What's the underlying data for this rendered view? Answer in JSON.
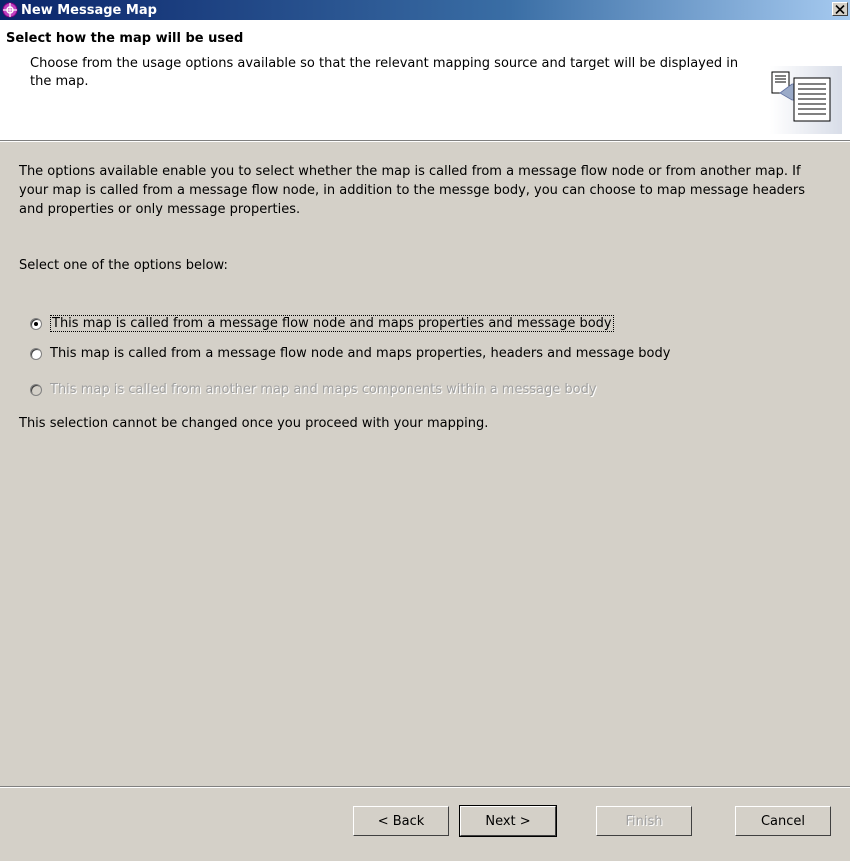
{
  "window": {
    "title": "New Message Map",
    "close_label": "✕"
  },
  "header": {
    "title": "Select how the map will be used",
    "description": "Choose from the usage options available so that the relevant mapping source and target will be displayed in the map."
  },
  "body": {
    "intro": "The options available enable you to select whether the map is called from a message flow node or from another map. If your map is called from a message flow node, in addition to the messge body, you can choose to map message headers and properties or only message properties.",
    "prompt": "Select one of the options below:",
    "options": [
      {
        "label": "This map is called from a message flow node and maps properties and message body",
        "selected": true,
        "enabled": true
      },
      {
        "label": "This map is called from a message flow node and maps properties, headers and message body",
        "selected": false,
        "enabled": true
      },
      {
        "label": "This map is called from another map and maps components within a message body",
        "selected": false,
        "enabled": false
      }
    ],
    "note": "This selection cannot be changed once you proceed with your mapping."
  },
  "buttons": {
    "back": "< Back",
    "next": "Next >",
    "finish": "Finish",
    "cancel": "Cancel"
  },
  "icons": {
    "title": "message-map-icon",
    "close": "close-icon",
    "header": "documents-icon"
  }
}
